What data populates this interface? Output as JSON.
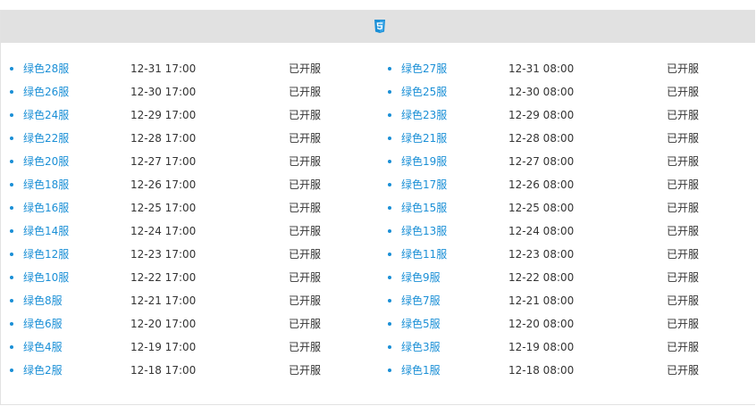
{
  "header": {
    "icon": "html5-icon",
    "accent_color": "#1a8fd6"
  },
  "columns": {
    "left": [
      {
        "name": "绿色28服",
        "time": "12-31 17:00",
        "status": "已开服"
      },
      {
        "name": "绿色26服",
        "time": "12-30 17:00",
        "status": "已开服"
      },
      {
        "name": "绿色24服",
        "time": "12-29 17:00",
        "status": "已开服"
      },
      {
        "name": "绿色22服",
        "time": "12-28 17:00",
        "status": "已开服"
      },
      {
        "name": "绿色20服",
        "time": "12-27 17:00",
        "status": "已开服"
      },
      {
        "name": "绿色18服",
        "time": "12-26 17:00",
        "status": "已开服"
      },
      {
        "name": "绿色16服",
        "time": "12-25 17:00",
        "status": "已开服"
      },
      {
        "name": "绿色14服",
        "time": "12-24 17:00",
        "status": "已开服"
      },
      {
        "name": "绿色12服",
        "time": "12-23 17:00",
        "status": "已开服"
      },
      {
        "name": "绿色10服",
        "time": "12-22 17:00",
        "status": "已开服"
      },
      {
        "name": "绿色8服",
        "time": "12-21 17:00",
        "status": "已开服"
      },
      {
        "name": "绿色6服",
        "time": "12-20 17:00",
        "status": "已开服"
      },
      {
        "name": "绿色4服",
        "time": "12-19 17:00",
        "status": "已开服"
      },
      {
        "name": "绿色2服",
        "time": "12-18 17:00",
        "status": "已开服"
      }
    ],
    "right": [
      {
        "name": "绿色27服",
        "time": "12-31 08:00",
        "status": "已开服"
      },
      {
        "name": "绿色25服",
        "time": "12-30 08:00",
        "status": "已开服"
      },
      {
        "name": "绿色23服",
        "time": "12-29 08:00",
        "status": "已开服"
      },
      {
        "name": "绿色21服",
        "time": "12-28 08:00",
        "status": "已开服"
      },
      {
        "name": "绿色19服",
        "time": "12-27 08:00",
        "status": "已开服"
      },
      {
        "name": "绿色17服",
        "time": "12-26 08:00",
        "status": "已开服"
      },
      {
        "name": "绿色15服",
        "time": "12-25 08:00",
        "status": "已开服"
      },
      {
        "name": "绿色13服",
        "time": "12-24 08:00",
        "status": "已开服"
      },
      {
        "name": "绿色11服",
        "time": "12-23 08:00",
        "status": "已开服"
      },
      {
        "name": "绿色9服",
        "time": "12-22 08:00",
        "status": "已开服"
      },
      {
        "name": "绿色7服",
        "time": "12-21 08:00",
        "status": "已开服"
      },
      {
        "name": "绿色5服",
        "time": "12-20 08:00",
        "status": "已开服"
      },
      {
        "name": "绿色3服",
        "time": "12-19 08:00",
        "status": "已开服"
      },
      {
        "name": "绿色1服",
        "time": "12-18 08:00",
        "status": "已开服"
      }
    ]
  }
}
